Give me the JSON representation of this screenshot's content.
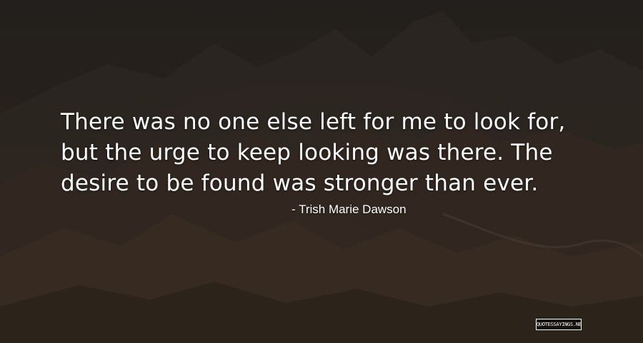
{
  "quote": {
    "lines": [
      "There was no one else left for me to look for,",
      "but the urge to keep looking was there. The",
      "desire to be found was stronger than ever."
    ],
    "author": "- Trish Marie Dawson"
  },
  "watermark": {
    "text": "QUOTESSAYINGS.NET"
  },
  "colors": {
    "text": "#ffffff",
    "background": "#2f2721"
  }
}
